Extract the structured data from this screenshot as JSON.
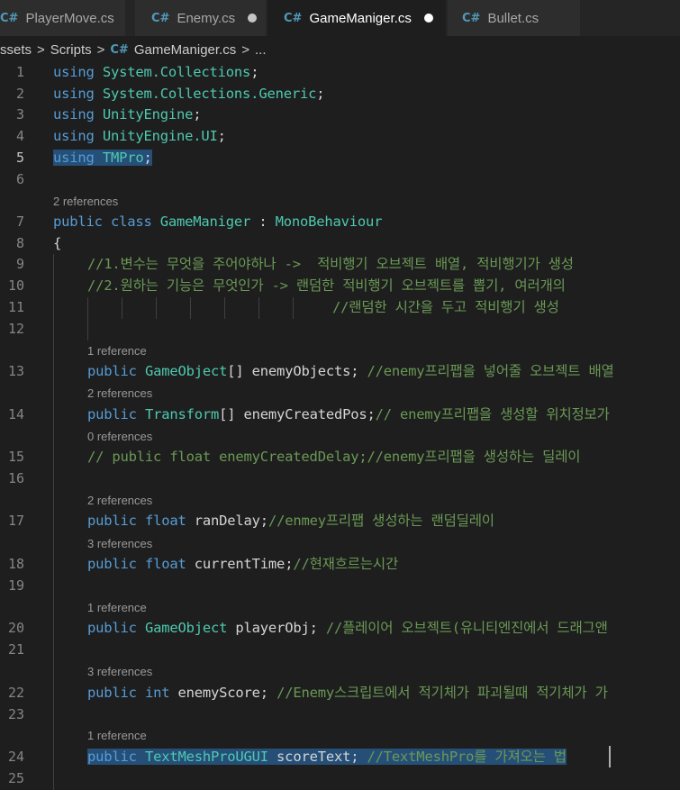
{
  "tabs": [
    {
      "label": "PlayerMove.cs",
      "icon": "csharp-icon",
      "modified": false,
      "active": false
    },
    {
      "label": "Enemy.cs",
      "icon": "csharp-icon",
      "modified": true,
      "active": false
    },
    {
      "label": "GameManiger.cs",
      "icon": "csharp-icon",
      "modified": true,
      "active": true
    },
    {
      "label": "Bullet.cs",
      "icon": "csharp-icon",
      "modified": false,
      "active": false
    }
  ],
  "icon_glyph": "C#",
  "breadcrumb": [
    "Assets",
    "Scripts",
    "GameManiger.cs",
    "..."
  ],
  "lens": {
    "l7": "2 references",
    "l13": "1 reference",
    "l14": "2 references",
    "l15": "0 references",
    "l17": "2 references",
    "l18": "3 references",
    "l20": "1 reference",
    "l22": "3 references",
    "l24": "1 reference"
  },
  "code": {
    "l1": {
      "kw": "using",
      "ns": "System.Collections",
      "end": ";"
    },
    "l2": {
      "kw": "using",
      "ns": "System.Collections.Generic",
      "end": ";"
    },
    "l3": {
      "kw": "using",
      "ns": "UnityEngine",
      "end": ";"
    },
    "l4": {
      "kw": "using",
      "ns": "UnityEngine.UI",
      "end": ";"
    },
    "l5": {
      "kw": "using",
      "ns": "TMPro",
      "end": ";"
    },
    "l7": {
      "kw1": "public",
      "kw2": "class",
      "name": "GameManiger",
      "colon": " : ",
      "base": "MonoBehaviour"
    },
    "l8": "{",
    "l9": "//1.변수는 무엇을 주어야하나 ->  적비행기 오브젝트 배열, 적비행기가 생성",
    "l10": "//2.원하는 기능은 무엇인가 -> 랜덤한 적비행기 오브젝트를 뽑기, 여러개의",
    "l11": "//랜덤한 시간을 두고 적비행기 생성",
    "l13": {
      "kw": "public",
      "ty": "GameObject",
      "rest": "[] enemyObjects; ",
      "cm": "//enemy프리팹을 넣어줄 오브젝트 배열"
    },
    "l14": {
      "kw": "public",
      "ty": "Transform",
      "rest": "[] enemyCreatedPos;",
      "cm": "// enemy프리팹을 생성할 위치정보가"
    },
    "l15": "// public float enemyCreatedDelay;//enemy프리팹을 생성하는 딜레이",
    "l17": {
      "kw": "public",
      "ty": "float",
      "rest": " ranDelay;",
      "cm": "//enmey프리팹 생성하는 랜덤딜레이"
    },
    "l18": {
      "kw": "public",
      "ty": "float",
      "rest": " currentTime;",
      "cm": "//현재흐르는시간"
    },
    "l20": {
      "kw": "public",
      "ty": "GameObject",
      "rest": " playerObj; ",
      "cm": "//플레이어 오브젝트(유니티엔진에서 드래그앤"
    },
    "l22": {
      "kw": "public",
      "ty": "int",
      "rest": " enemyScore; ",
      "cm": "//Enemy스크립트에서 적기체가 파괴될때 적기체가 가"
    },
    "l24": {
      "kw": "public",
      "ty": "TextMeshProUGUI",
      "rest": " scoreText; ",
      "cm": "//TextMeshPro를 가져오는 법"
    }
  },
  "line_numbers": [
    "1",
    "2",
    "3",
    "4",
    "5",
    "6",
    "7",
    "8",
    "9",
    "10",
    "11",
    "12",
    "13",
    "14",
    "15",
    "16",
    "17",
    "18",
    "19",
    "20",
    "21",
    "22",
    "23",
    "24",
    "25"
  ],
  "colors": {
    "editor_bg": "#1e1e1e",
    "keyword": "#569cd6",
    "type": "#4ec9b0",
    "comment": "#6a9955",
    "selection": "#264f78"
  }
}
